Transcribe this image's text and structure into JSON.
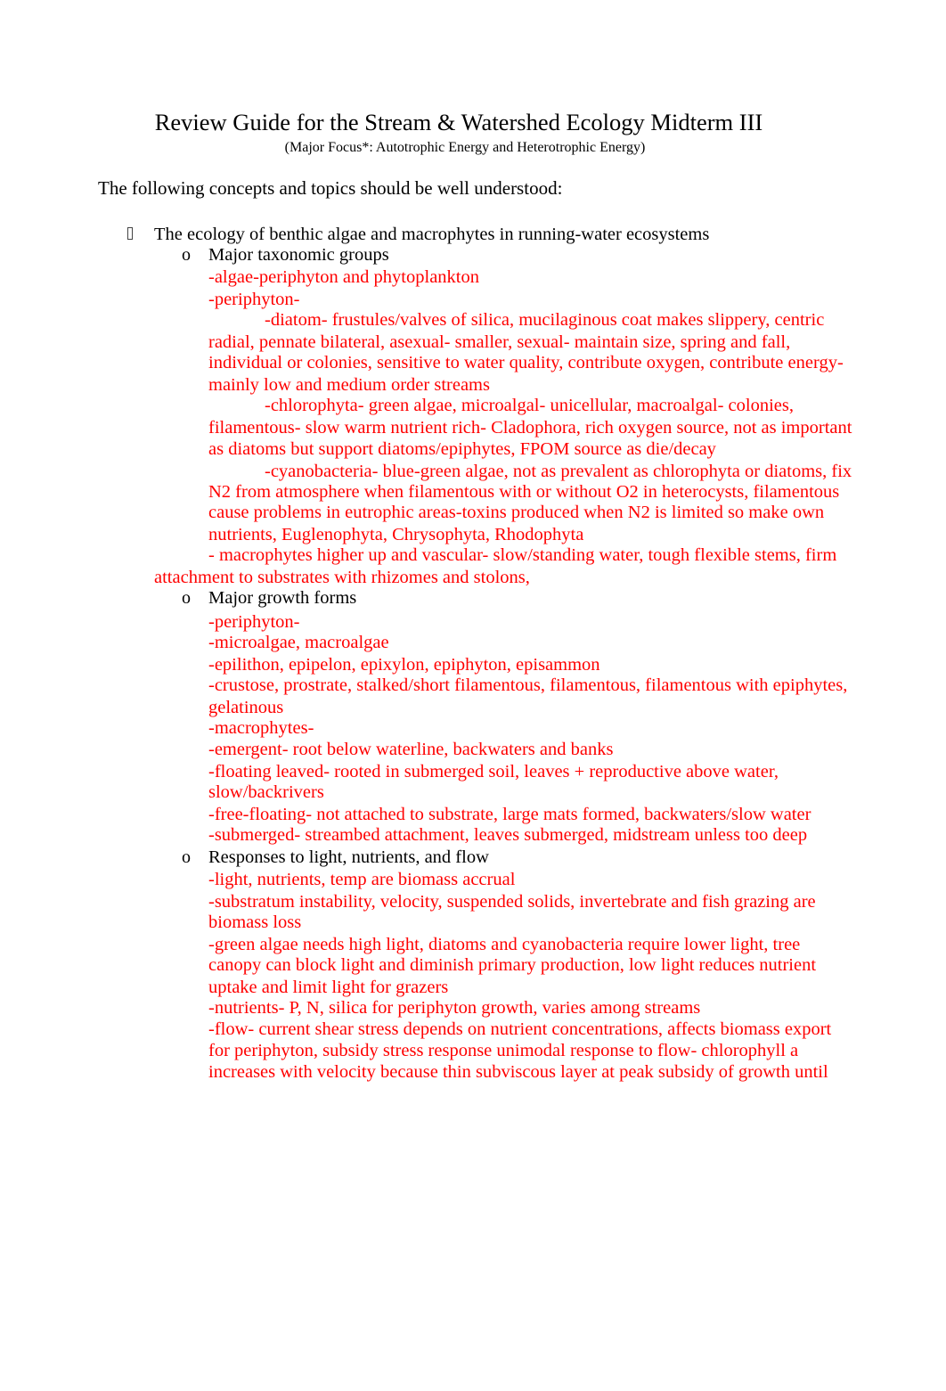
{
  "document": {
    "title": "Review Guide for the Stream & Watershed Ecology Midterm III",
    "subtitle": "(Major Focus*: Autotrophic Energy and Heterotrophic Energy)",
    "intro": "The following concepts and topics should be well understood:",
    "colors": {
      "notes": "#ff0000",
      "text": "#000000"
    },
    "topic": {
      "bullet_icon": "missing-glyph-box",
      "label": "The ecology of benthic algae and macrophytes in running-water ecosystems",
      "subtopics": [
        {
          "bullet": "o",
          "label": "Major taxonomic groups",
          "notes": [
            "-algae-periphyton and phytoplankton",
            "-periphyton-",
            "-diatom- frustules/valves of silica, mucilaginous coat makes slippery, centric",
            "radial, pennate bilateral, asexual- smaller, sexual- maintain size, spring and fall,",
            "individual or colonies, sensitive to water quality, contribute oxygen, contribute energy-",
            "mainly low and medium order streams",
            "-chlorophyta- green algae, microalgal- unicellular, macroalgal- colonies,",
            "filamentous- slow warm nutrient rich- Cladophora, rich oxygen source, not as important",
            "as diatoms but support diatoms/epiphytes, FPOM source as die/decay",
            "-cyanobacteria- blue-green algae, not as prevalent as chlorophyta or diatoms, fix",
            "N2 from atmosphere when filamentous with or without O2 in heterocysts, filamentous",
            "cause problems in eutrophic areas-toxins produced when N2 is limited so make own",
            "nutrients, Euglenophyta, Chrysophyta, Rhodophyta",
            "- macrophytes higher up and vascular- slow/standing water, tough flexible stems, firm",
            "attachment to substrates with rhizomes and stolons,"
          ]
        },
        {
          "bullet": "o",
          "label": "Major growth forms",
          "notes": [
            "-periphyton-",
            "-microalgae, macroalgae",
            "-epilithon, epipelon, epixylon, epiphyton, episammon",
            "-crustose, prostrate, stalked/short filamentous, filamentous, filamentous with epiphytes,",
            "gelatinous",
            "-macrophytes-",
            "-emergent- root below waterline, backwaters and banks",
            "-floating leaved- rooted in submerged soil, leaves + reproductive above water,",
            "slow/backrivers",
            "-free-floating- not attached to substrate, large mats formed, backwaters/slow water",
            "-submerged- streambed attachment, leaves submerged, midstream unless too deep"
          ]
        },
        {
          "bullet": "o",
          "label": "Responses to light, nutrients, and flow",
          "notes": [
            "-light, nutrients, temp are biomass accrual",
            "-substratum instability, velocity, suspended solids, invertebrate and fish grazing are",
            "biomass loss",
            "-green algae needs high light, diatoms and cyanobacteria require lower light, tree",
            "canopy can block light and diminish primary production, low light reduces nutrient",
            "uptake and limit light for grazers",
            "-nutrients- P, N, silica for periphyton growth, varies among streams",
            "-flow- current shear stress depends on nutrient concentrations, affects biomass export",
            "for periphyton, subsidy stress response unimodal response to flow- chlorophyll a",
            "increases with velocity because thin subviscous layer at peak subsidy of growth until"
          ]
        }
      ]
    }
  }
}
